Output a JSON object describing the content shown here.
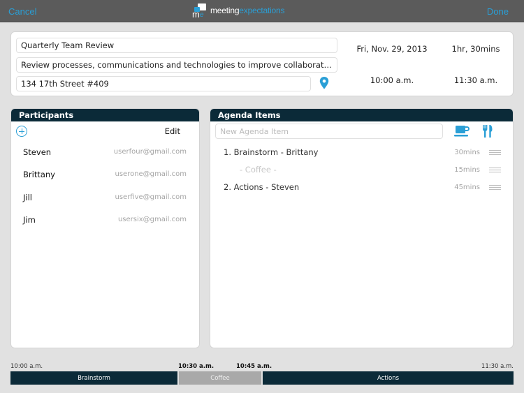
{
  "topbar": {
    "cancel_label": "Cancel",
    "done_label": "Done",
    "logo": {
      "mark_m": "m",
      "mark_e": "e",
      "word1": "meeting",
      "word2": "expectations"
    }
  },
  "meeting": {
    "title": "Quarterly Team Review",
    "description": "Review processes, communications and technologies to improve collaboration, act on l…",
    "location": "134 17th Street #409",
    "date": "Fri, Nov. 29, 2013",
    "duration": "1hr, 30mins",
    "start_time": "10:00 a.m.",
    "end_time": "11:30 a.m."
  },
  "participants": {
    "header": "Participants",
    "edit_label": "Edit",
    "items": [
      {
        "name": "Steven",
        "email": "userfour@gmail.com"
      },
      {
        "name": "Brittany",
        "email": "userone@gmail.com"
      },
      {
        "name": "Jill",
        "email": "userfive@gmail.com"
      },
      {
        "name": "Jim",
        "email": "usersix@gmail.com"
      }
    ]
  },
  "agenda": {
    "header": "Agenda Items",
    "new_item_placeholder": "New Agenda Item",
    "items": [
      {
        "title": "1. Brainstorm - Brittany",
        "duration": "30mins"
      },
      {
        "title": "- Coffee -",
        "duration": "15mins"
      },
      {
        "title": "2. Actions - Steven",
        "duration": "45mins"
      }
    ]
  },
  "timeline": {
    "labels": [
      "10:00 a.m.",
      "10:30 a.m.",
      "10:45 a.m.",
      "11:30 a.m."
    ],
    "segments": [
      {
        "label": "Brainstorm",
        "type": "main"
      },
      {
        "label": "Coffee",
        "type": "break"
      },
      {
        "label": "Actions",
        "type": "main"
      }
    ]
  },
  "colors": {
    "accent": "#2a9fd6",
    "header_dark": "#0b2a38",
    "topbar": "#5b5b5b",
    "break_gray": "#a9a9a9"
  }
}
